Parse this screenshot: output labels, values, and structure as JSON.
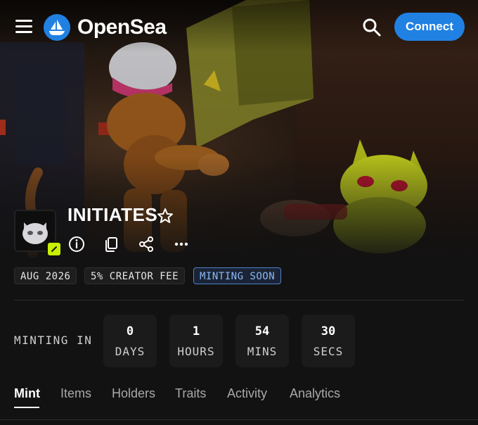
{
  "header": {
    "brand": "OpenSea",
    "connect_label": "Connect",
    "icons": {
      "menu": "hamburger-menu-icon",
      "logo": "opensea-ship-logo",
      "search": "search-icon"
    }
  },
  "collection": {
    "title": "INITIATES",
    "icons": [
      "info-icon",
      "copy-icon",
      "share-icon",
      "more-icon"
    ],
    "tags": [
      {
        "label": "AUG 2026"
      },
      {
        "label": "5% CREATOR FEE"
      },
      {
        "label": "MINTING SOON"
      }
    ]
  },
  "countdown": {
    "label": "MINTING IN",
    "units": [
      {
        "value": "0",
        "unit": "DAYS"
      },
      {
        "value": "1",
        "unit": "HOURS"
      },
      {
        "value": "54",
        "unit": "MINS"
      },
      {
        "value": "30",
        "unit": "SECS"
      }
    ]
  },
  "tabs": [
    {
      "label": "Mint",
      "active": true
    },
    {
      "label": "Items"
    },
    {
      "label": "Holders"
    },
    {
      "label": "Traits"
    },
    {
      "label": "Activity"
    },
    {
      "label": "Analytics"
    }
  ],
  "colors": {
    "accent": "#2081e2",
    "background": "#121212",
    "badge": "#c8f000",
    "tag_blue": "#8eb8f2"
  }
}
